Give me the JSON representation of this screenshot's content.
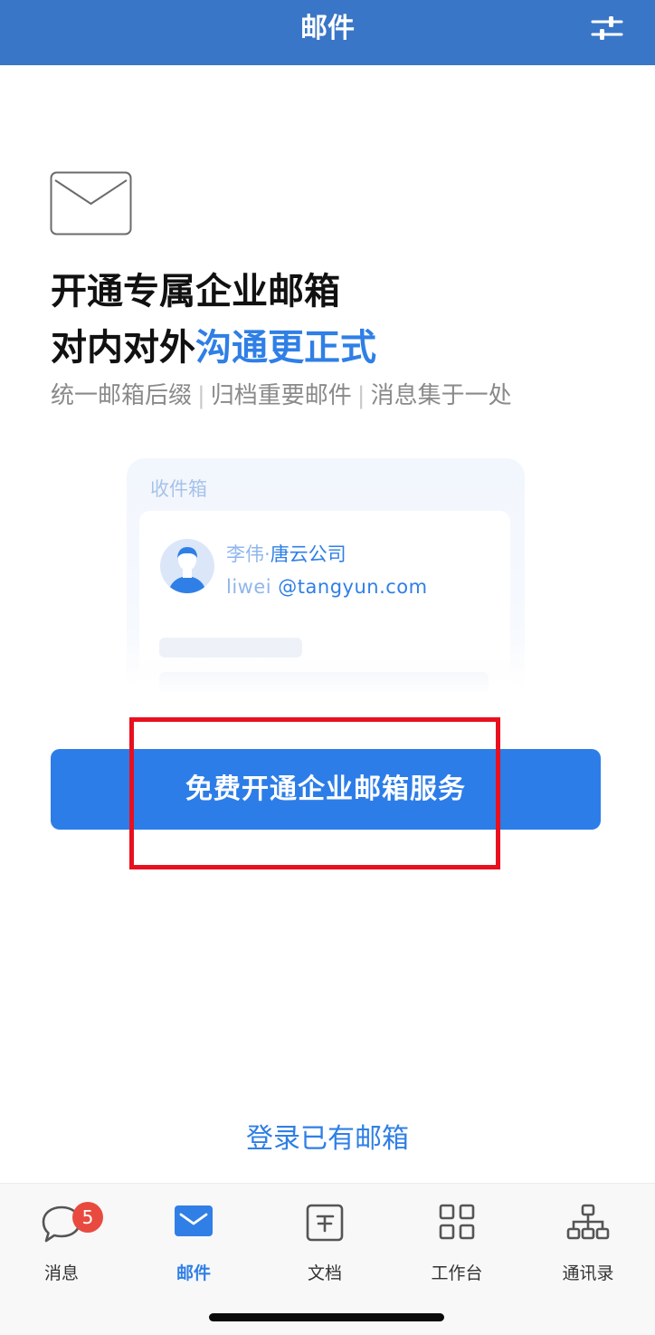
{
  "header": {
    "title": "邮件",
    "filter_icon": "sliders-icon"
  },
  "intro": {
    "icon": "envelope-icon",
    "headline_line1": "开通专属企业邮箱",
    "headline_line2_plain": "对内对外",
    "headline_line2_accent": "沟通更正式",
    "taglines": [
      "统一邮箱后缀",
      "归档重要邮件",
      "消息集于一处"
    ],
    "separator": "|"
  },
  "preview": {
    "label": "收件箱",
    "contact_name": "李伟",
    "contact_dot": "·",
    "contact_company": "唐云公司",
    "email_user": "liwei",
    "email_domain": "@tangyun.com"
  },
  "cta": {
    "label": "免费开通企业邮箱服务"
  },
  "login": {
    "label": "登录已有邮箱"
  },
  "tabs": [
    {
      "label": "消息",
      "icon": "chat-bubble-icon",
      "badge": "5"
    },
    {
      "label": "邮件",
      "icon": "mail-icon"
    },
    {
      "label": "文档",
      "icon": "document-icon"
    },
    {
      "label": "工作台",
      "icon": "grid-icon"
    },
    {
      "label": "通讯录",
      "icon": "org-chart-icon"
    }
  ],
  "colors": {
    "header_bg": "#3a76c7",
    "accent": "#2f7fe6",
    "cta_bg": "#2d7de8",
    "badge": "#e94a3f",
    "highlight": "#e8101e"
  }
}
